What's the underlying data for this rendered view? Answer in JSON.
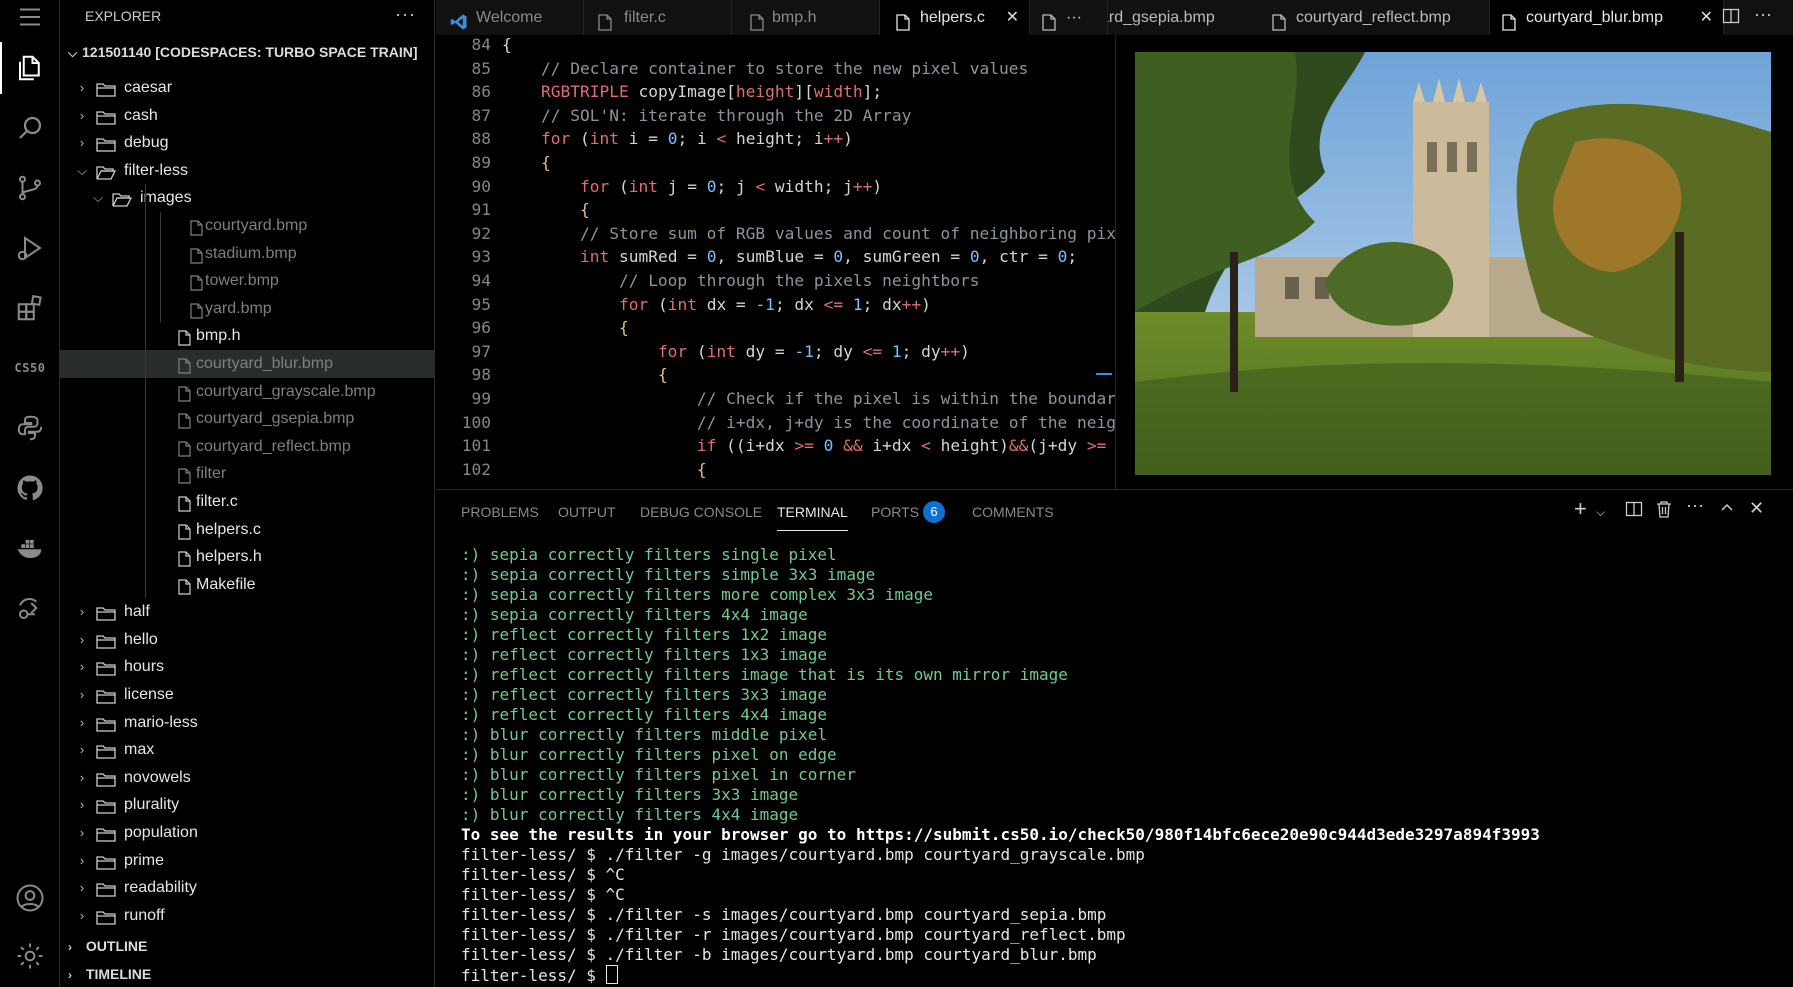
{
  "sidebar": {
    "title": "EXPLORER",
    "more": "···",
    "workspace": "121501140 [CODESPACES: TURBO SPACE TRAIN]",
    "tree": [
      {
        "label": "caesar",
        "type": "folder",
        "depth": 0,
        "open": false
      },
      {
        "label": "cash",
        "type": "folder",
        "depth": 0,
        "open": false
      },
      {
        "label": "debug",
        "type": "folder",
        "depth": 0,
        "open": false
      },
      {
        "label": "filter-less",
        "type": "folder",
        "depth": 0,
        "open": true
      },
      {
        "label": "images",
        "type": "folder",
        "depth": 1,
        "open": true
      },
      {
        "label": "courtyard.bmp",
        "type": "file",
        "depth": 2,
        "dim": true
      },
      {
        "label": "stadium.bmp",
        "type": "file",
        "depth": 2,
        "dim": true
      },
      {
        "label": "tower.bmp",
        "type": "file",
        "depth": 2,
        "dim": true
      },
      {
        "label": "yard.bmp",
        "type": "file",
        "depth": 2,
        "dim": true
      },
      {
        "label": "bmp.h",
        "type": "file",
        "depth": 1
      },
      {
        "label": "courtyard_blur.bmp",
        "type": "file",
        "depth": 1,
        "dim": true,
        "selected": true
      },
      {
        "label": "courtyard_grayscale.bmp",
        "type": "file",
        "depth": 1,
        "dim": true
      },
      {
        "label": "courtyard_gsepia.bmp",
        "type": "file",
        "depth": 1,
        "dim": true
      },
      {
        "label": "courtyard_reflect.bmp",
        "type": "file",
        "depth": 1,
        "dim": true
      },
      {
        "label": "filter",
        "type": "file",
        "depth": 1,
        "dim": true
      },
      {
        "label": "filter.c",
        "type": "file",
        "depth": 1
      },
      {
        "label": "helpers.c",
        "type": "file",
        "depth": 1
      },
      {
        "label": "helpers.h",
        "type": "file",
        "depth": 1
      },
      {
        "label": "Makefile",
        "type": "file",
        "depth": 1
      },
      {
        "label": "half",
        "type": "folder",
        "depth": 0,
        "open": false
      },
      {
        "label": "hello",
        "type": "folder",
        "depth": 0,
        "open": false
      },
      {
        "label": "hours",
        "type": "folder",
        "depth": 0,
        "open": false
      },
      {
        "label": "license",
        "type": "folder",
        "depth": 0,
        "open": false
      },
      {
        "label": "mario-less",
        "type": "folder",
        "depth": 0,
        "open": false
      },
      {
        "label": "max",
        "type": "folder",
        "depth": 0,
        "open": false
      },
      {
        "label": "novowels",
        "type": "folder",
        "depth": 0,
        "open": false
      },
      {
        "label": "plurality",
        "type": "folder",
        "depth": 0,
        "open": false
      },
      {
        "label": "population",
        "type": "folder",
        "depth": 0,
        "open": false
      },
      {
        "label": "prime",
        "type": "folder",
        "depth": 0,
        "open": false
      },
      {
        "label": "readability",
        "type": "folder",
        "depth": 0,
        "open": false
      },
      {
        "label": "runoff",
        "type": "folder",
        "depth": 0,
        "open": false
      }
    ],
    "outline": "OUTLINE",
    "timeline": "TIMELINE"
  },
  "activity_bar": {
    "cs50_label": "CS50",
    "icons": [
      "menu-icon",
      "explorer-icon",
      "search-icon",
      "source-control-icon",
      "run-debug-icon",
      "extensions-icon",
      "cs50-icon",
      "python-icon",
      "github-icon",
      "docker-icon",
      "remote-icon",
      "account-icon",
      "settings-icon"
    ]
  },
  "tabs": [
    {
      "label": "Welcome",
      "icon": "vscode-icon"
    },
    {
      "label": "filter.c",
      "icon": "file-icon"
    },
    {
      "label": "bmp.h",
      "icon": "file-icon"
    },
    {
      "label": "helpers.c",
      "icon": "file-icon",
      "active": true
    },
    {
      "label": "ard_gsepia.bmp",
      "icon": "none"
    },
    {
      "label": "courtyard_reflect.bmp",
      "icon": "file-icon"
    },
    {
      "label": "courtyard_blur.bmp",
      "icon": "file-icon",
      "active": true
    }
  ],
  "editor": {
    "line_numbers": [
      "84",
      "85",
      "86",
      "87",
      "88",
      "89",
      "90",
      "91",
      "92",
      "93",
      "94",
      "95",
      "96",
      "97",
      "98",
      "99",
      "100",
      "101",
      "102"
    ]
  },
  "panel": {
    "tabs": [
      "PROBLEMS",
      "OUTPUT",
      "DEBUG CONSOLE",
      "TERMINAL",
      "PORTS",
      "COMMENTS"
    ],
    "active_tab": "TERMINAL",
    "ports_badge": "6",
    "terminal_lines": [
      {
        "text": ":) sepia correctly filters single pixel",
        "style": "ok"
      },
      {
        "text": ":) sepia correctly filters simple 3x3 image",
        "style": "ok"
      },
      {
        "text": ":) sepia correctly filters more complex 3x3 image",
        "style": "ok"
      },
      {
        "text": ":) sepia correctly filters 4x4 image",
        "style": "ok"
      },
      {
        "text": ":) reflect correctly filters 1x2 image",
        "style": "ok"
      },
      {
        "text": ":) reflect correctly filters 1x3 image",
        "style": "ok"
      },
      {
        "text": ":) reflect correctly filters image that is its own mirror image",
        "style": "ok"
      },
      {
        "text": ":) reflect correctly filters 3x3 image",
        "style": "ok"
      },
      {
        "text": ":) reflect correctly filters 4x4 image",
        "style": "ok"
      },
      {
        "text": ":) blur correctly filters middle pixel",
        "style": "ok"
      },
      {
        "text": ":) blur correctly filters pixel on edge",
        "style": "ok"
      },
      {
        "text": ":) blur correctly filters pixel in corner",
        "style": "ok"
      },
      {
        "text": ":) blur correctly filters 3x3 image",
        "style": "ok"
      },
      {
        "text": ":) blur correctly filters 4x4 image",
        "style": "ok"
      },
      {
        "text": "To see the results in your browser go to https://submit.cs50.io/check50/980f14bfc6ece20e90c944d3ede3297a894f3993",
        "style": "b"
      },
      {
        "text": "filter-less/ $ ./filter -g images/courtyard.bmp courtyard_grayscale.bmp",
        "style": "wh"
      },
      {
        "text": "filter-less/ $ ^C",
        "style": "wh"
      },
      {
        "text": "filter-less/ $ ^C",
        "style": "wh"
      },
      {
        "text": "filter-less/ $ ./filter -s images/courtyard.bmp courtyard_sepia.bmp",
        "style": "wh"
      },
      {
        "text": "filter-less/ $ ./filter -r images/courtyard.bmp courtyard_reflect.bmp",
        "style": "wh"
      },
      {
        "text": "filter-less/ $ ./filter -b images/courtyard.bmp courtyard_blur.bmp",
        "style": "wh"
      }
    ],
    "prompt": "filter-less/ $ "
  },
  "colors": {
    "accent": "#0e70d1",
    "ok": "#73c991",
    "keyword": "#e06c75",
    "number": "#79c0ff",
    "comment": "#8b949e"
  }
}
